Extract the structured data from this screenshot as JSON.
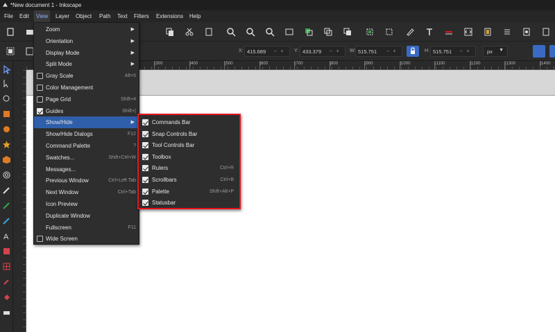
{
  "window": {
    "title": "*New document 1 - Inkscape"
  },
  "menubar": {
    "items": [
      {
        "label": "File"
      },
      {
        "label": "Edit"
      },
      {
        "label": "View"
      },
      {
        "label": "Layer"
      },
      {
        "label": "Object"
      },
      {
        "label": "Path"
      },
      {
        "label": "Text"
      },
      {
        "label": "Filters"
      },
      {
        "label": "Extensions"
      },
      {
        "label": "Help"
      }
    ],
    "active": "View"
  },
  "toolcontrols": {
    "x": {
      "label": "X:",
      "value": "415.689"
    },
    "y": {
      "label": "Y:",
      "value": "433.379"
    },
    "w": {
      "label": "W:",
      "value": "515.751"
    },
    "h": {
      "label": "H:",
      "value": "515.751"
    },
    "unit": "px"
  },
  "ruler": {
    "labels": [
      "|300",
      "|400",
      "|500",
      "|600",
      "|700",
      "|800",
      "|900",
      "|1000",
      "|1100",
      "|1200",
      "|1300",
      "|1400"
    ]
  },
  "view_menu": {
    "items": [
      {
        "label": "Zoom",
        "shortcut": "",
        "submenu": true
      },
      {
        "label": "Orientation",
        "shortcut": "",
        "submenu": true
      },
      {
        "label": "Display Mode",
        "shortcut": "",
        "submenu": true
      },
      {
        "label": "Split Mode",
        "shortcut": "",
        "submenu": true
      },
      {
        "label": "Gray Scale",
        "shortcut": "Alt+5",
        "checkbox": true,
        "checked": false
      },
      {
        "label": "Color Management",
        "shortcut": "",
        "checkbox": true,
        "checked": false
      },
      {
        "label": "Page Grid",
        "shortcut": "Shift+#",
        "checkbox": true,
        "checked": false
      },
      {
        "label": "Guides",
        "shortcut": "Shift+|",
        "checkbox": true,
        "checked": true
      },
      {
        "label": "Show/Hide",
        "shortcut": "",
        "submenu": true,
        "highlighted": true
      },
      {
        "label": "Show/Hide Dialogs",
        "shortcut": "F12"
      },
      {
        "label": "Command Palette",
        "shortcut": "?"
      },
      {
        "label": "Swatches...",
        "shortcut": "Shift+Ctrl+W"
      },
      {
        "label": "Messages...",
        "shortcut": ""
      },
      {
        "label": "Previous Window",
        "shortcut": "Ctrl+Left Tab"
      },
      {
        "label": "Next Window",
        "shortcut": "Ctrl+Tab"
      },
      {
        "label": "Icon Preview",
        "shortcut": ""
      },
      {
        "label": "Duplicate Window",
        "shortcut": ""
      },
      {
        "label": "Fullscreen",
        "shortcut": "F11"
      },
      {
        "label": "Wide Screen",
        "shortcut": "",
        "checkbox": true,
        "checked": false
      }
    ]
  },
  "showhide_menu": {
    "items": [
      {
        "label": "Commands Bar",
        "shortcut": "",
        "checked": true
      },
      {
        "label": "Snap Controls Bar",
        "shortcut": "",
        "checked": true
      },
      {
        "label": "Tool Controls Bar",
        "shortcut": "",
        "checked": true
      },
      {
        "label": "Toolbox",
        "shortcut": "",
        "checked": true
      },
      {
        "label": "Rulers",
        "shortcut": "Ctrl+R",
        "checked": true
      },
      {
        "label": "Scrollbars",
        "shortcut": "Ctrl+B",
        "checked": true
      },
      {
        "label": "Palette",
        "shortcut": "Shift+Alt+P",
        "checked": true
      },
      {
        "label": "Statusbar",
        "shortcut": "",
        "checked": true
      }
    ],
    "highlight_color": "#e8131b"
  },
  "colors": {
    "accent": "#3a6bc4",
    "menu_highlight": "#2f5faa",
    "callout": "#e8131b"
  }
}
